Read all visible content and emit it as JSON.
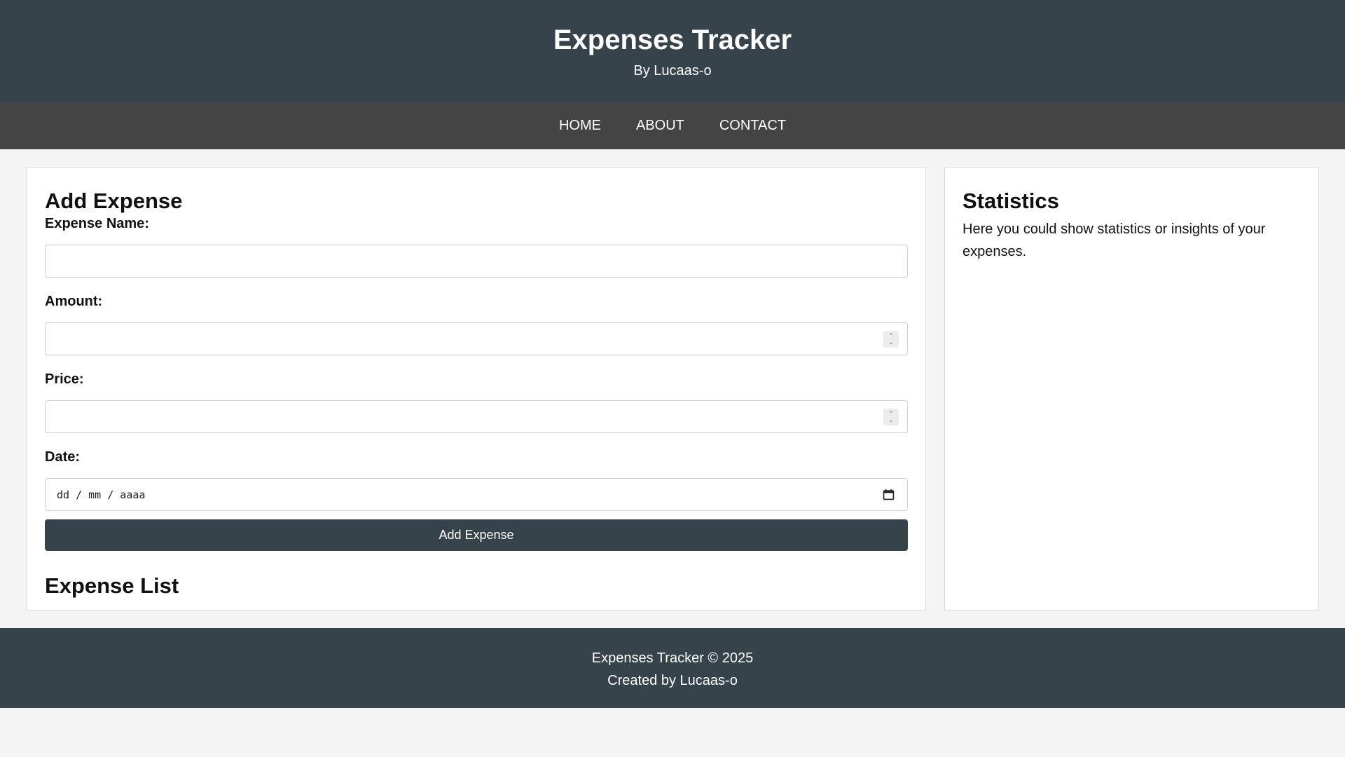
{
  "header": {
    "title": "Expenses Tracker",
    "subtitle": "By Lucaas-o"
  },
  "nav": {
    "items": [
      "HOME",
      "ABOUT",
      "CONTACT"
    ]
  },
  "form": {
    "heading": "Add Expense",
    "name_label": "Expense Name:",
    "amount_label": "Amount:",
    "price_label": "Price:",
    "date_label": "Date:",
    "date_placeholder": "dd / mm / aaaa",
    "submit_label": "Add Expense"
  },
  "list": {
    "heading": "Expense List"
  },
  "stats": {
    "heading": "Statistics",
    "text": "Here you could show statistics or insights of your expenses."
  },
  "footer": {
    "line1": "Expenses Tracker © 2025",
    "line2": "Created by Lucaas-o"
  }
}
